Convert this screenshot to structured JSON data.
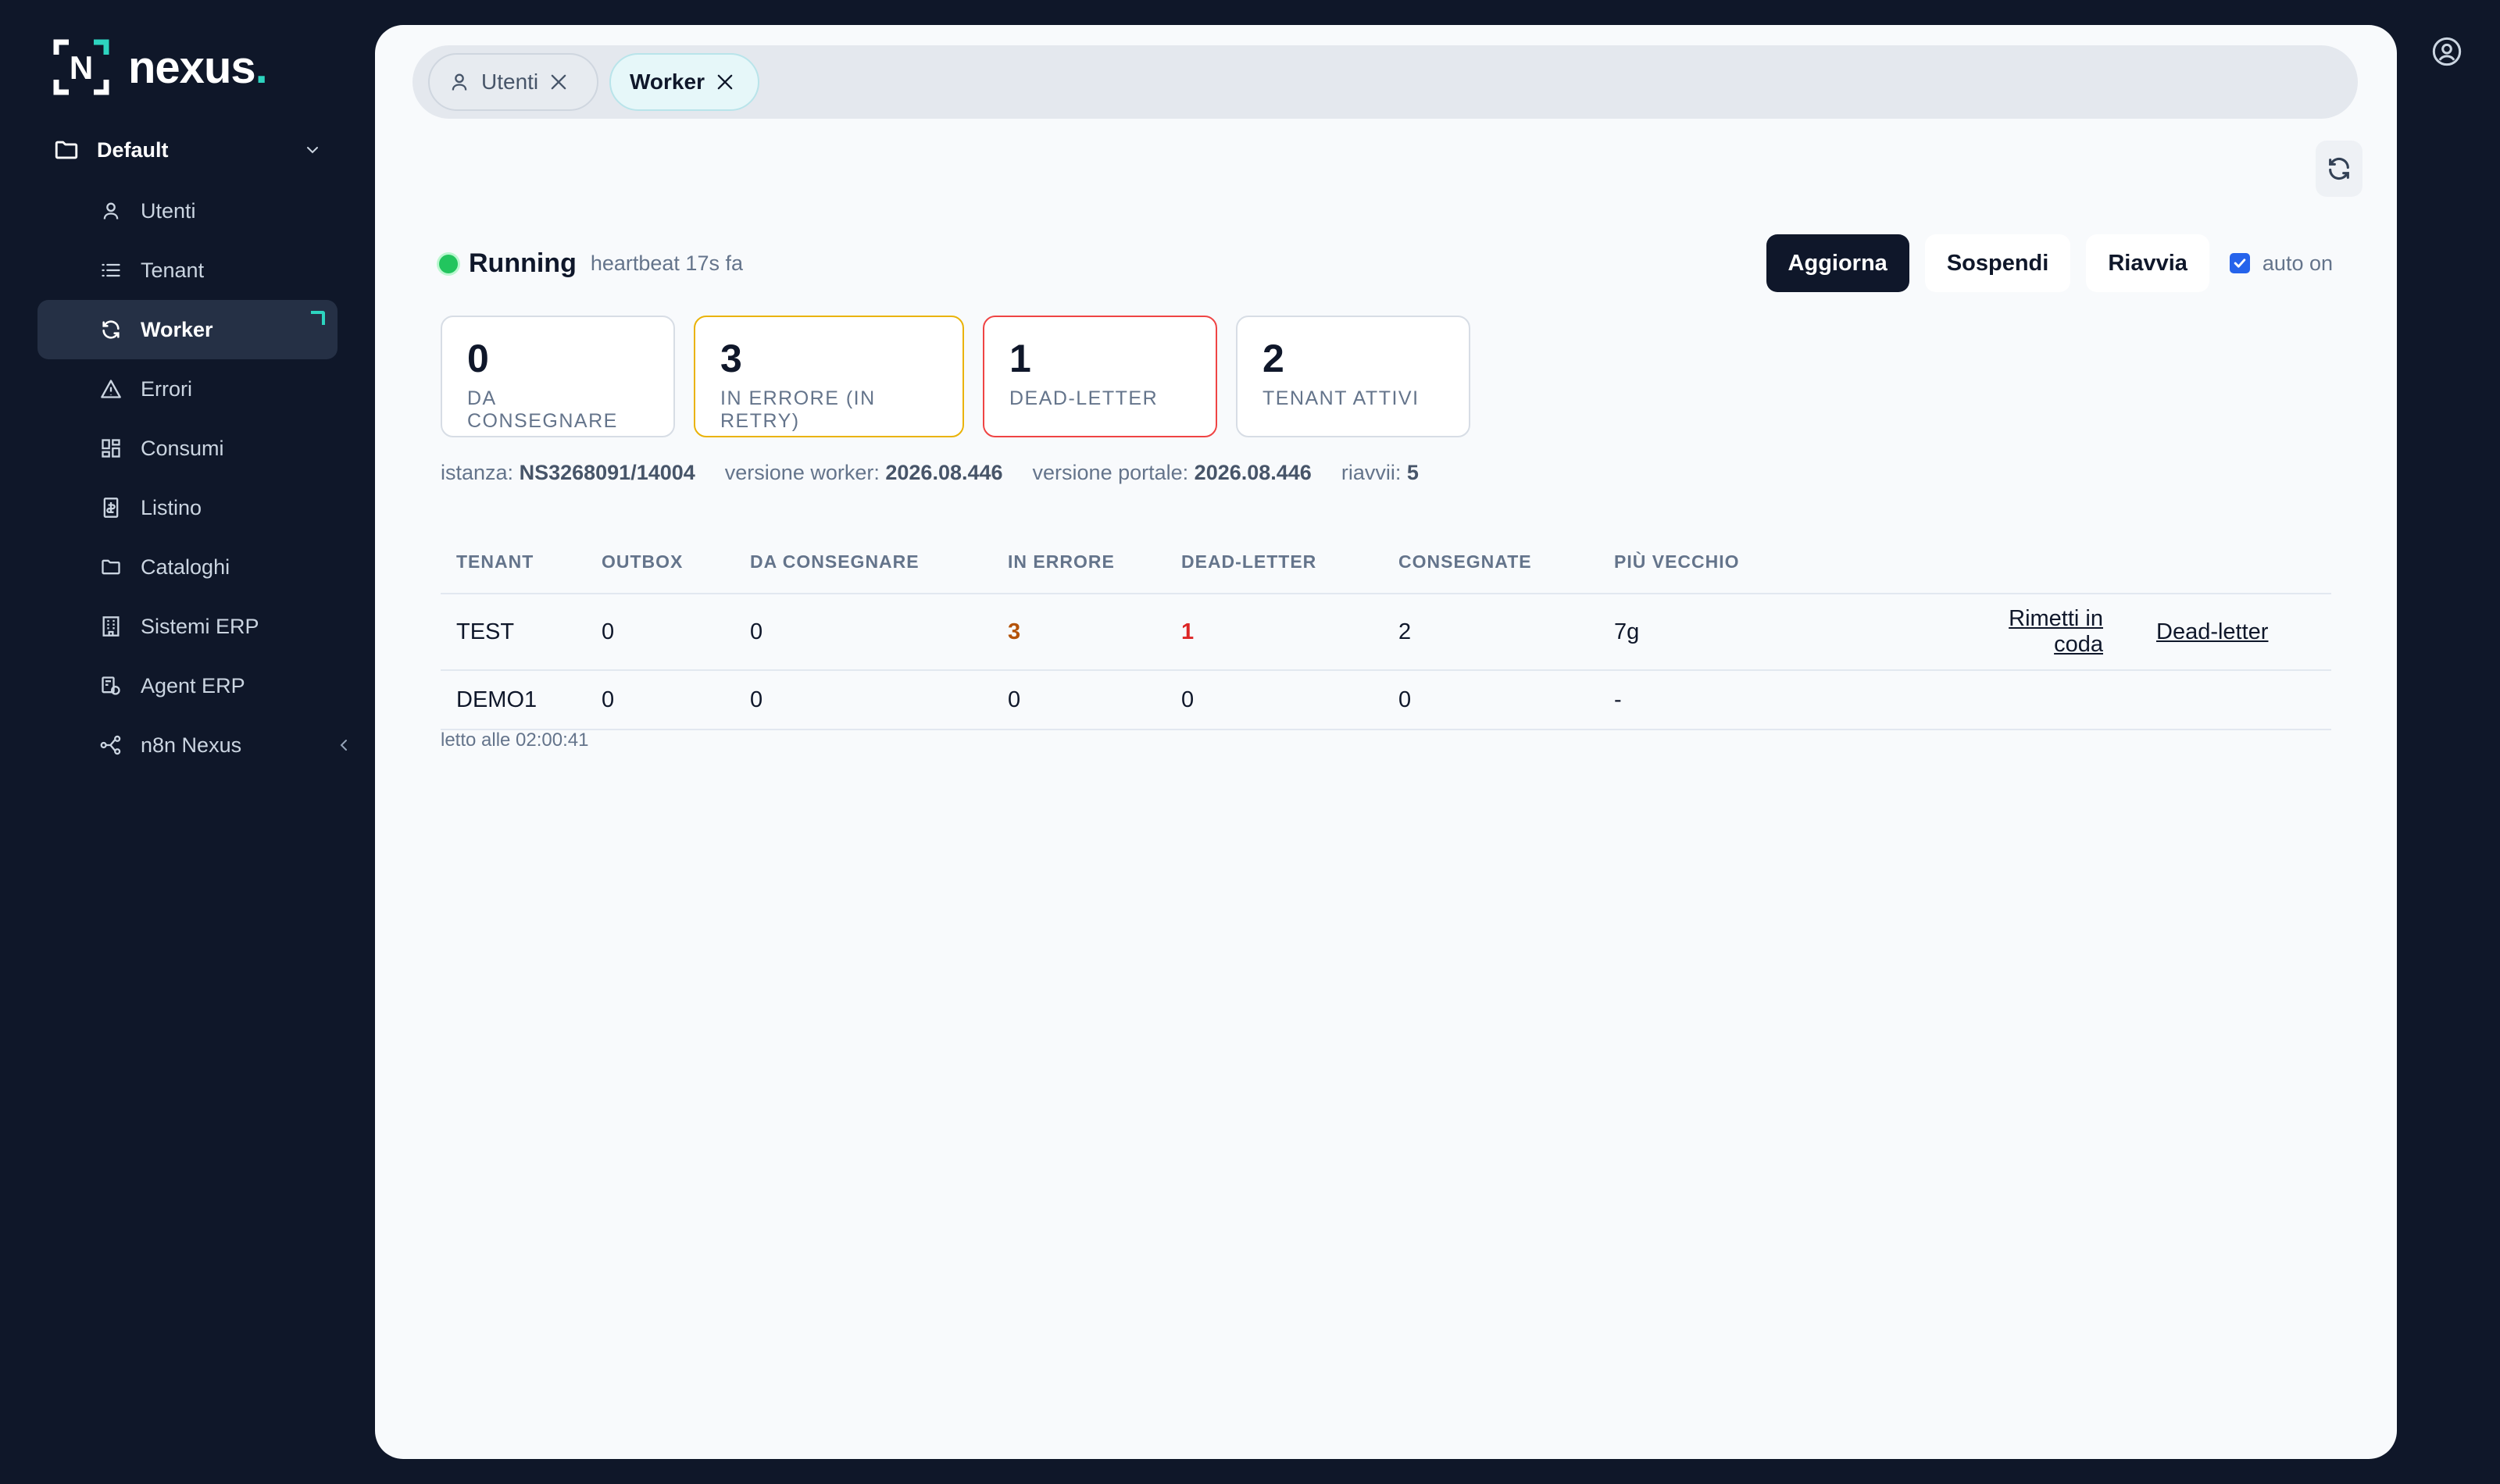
{
  "brand": {
    "name": "nexus",
    "dot": ".",
    "mark_letter": "N",
    "accent": "#2dd4bf"
  },
  "sidebar": {
    "group": {
      "label": "Default"
    },
    "items": [
      {
        "label": "Utenti",
        "icon": "user-icon"
      },
      {
        "label": "Tenant",
        "icon": "list-icon"
      },
      {
        "label": "Worker",
        "icon": "refresh-icon",
        "active": true
      },
      {
        "label": "Errori",
        "icon": "warning-icon"
      },
      {
        "label": "Consumi",
        "icon": "grid-icon"
      },
      {
        "label": "Listino",
        "icon": "pricelist-icon"
      },
      {
        "label": "Cataloghi",
        "icon": "folder-icon"
      },
      {
        "label": "Sistemi ERP",
        "icon": "building-icon"
      },
      {
        "label": "Agent ERP",
        "icon": "agent-icon"
      },
      {
        "label": "n8n Nexus",
        "icon": "share-icon"
      }
    ]
  },
  "tabs": [
    {
      "label": "Utenti",
      "icon": "user-icon"
    },
    {
      "label": "Worker",
      "active": true
    }
  ],
  "status": {
    "state": "Running",
    "heartbeat": "heartbeat 17s fa",
    "color": "#22c55e"
  },
  "actions": {
    "refresh": "Aggiorna",
    "suspend": "Sospendi",
    "restart": "Riavvia",
    "auto_label": "auto on",
    "auto_checked": true
  },
  "stats": [
    {
      "value": "0",
      "label": "DA CONSEGNARE"
    },
    {
      "value": "3",
      "label": "IN ERRORE (IN RETRY)"
    },
    {
      "value": "1",
      "label": "DEAD-LETTER"
    },
    {
      "value": "2",
      "label": "TENANT ATTIVI"
    }
  ],
  "meta": {
    "instance_label": "istanza:",
    "instance": "NS3268091/14004",
    "worker_label": "versione worker:",
    "worker": "2026.08.446",
    "portal_label": "versione portale:",
    "portal": "2026.08.446",
    "restarts_label": "riavvii:",
    "restarts": "5"
  },
  "table": {
    "columns": [
      "TENANT",
      "OUTBOX",
      "DA CONSEGNARE",
      "IN ERRORE",
      "DEAD-LETTER",
      "CONSEGNATE",
      "PIÙ VECCHIO"
    ],
    "rows": [
      {
        "tenant": "TEST",
        "outbox": "0",
        "pending": "0",
        "errors": "3",
        "dead": "1",
        "delivered": "2",
        "oldest": "7g",
        "requeue": "Rimetti in coda",
        "deadletter": "Dead-letter"
      },
      {
        "tenant": "DEMO1",
        "outbox": "0",
        "pending": "0",
        "errors": "0",
        "dead": "0",
        "delivered": "0",
        "oldest": "-"
      }
    ]
  },
  "read_time": "letto alle 02:00:41"
}
